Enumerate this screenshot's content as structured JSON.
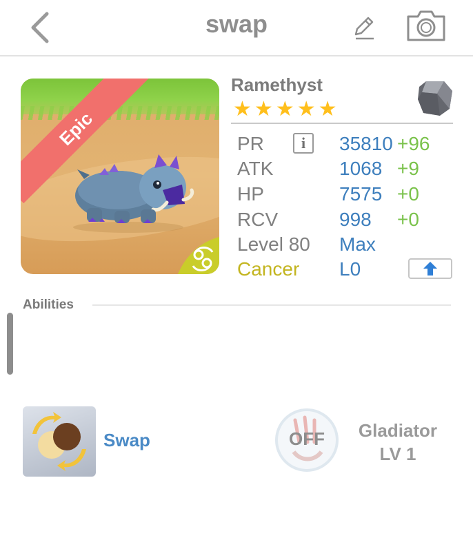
{
  "nav": {
    "title": "swap"
  },
  "card": {
    "rarity": "Epic"
  },
  "monster": {
    "name": "Ramethyst",
    "stars": 5,
    "element_icon": "gray-rock-gem-icon"
  },
  "stats": {
    "pr": {
      "label": "PR",
      "value": "35810",
      "bonus": "+96"
    },
    "atk": {
      "label": "ATK",
      "value": "1068",
      "bonus": "+9"
    },
    "hp": {
      "label": "HP",
      "value": "7575",
      "bonus": "+0"
    },
    "rcv": {
      "label": "RCV",
      "value": "998",
      "bonus": "+0"
    },
    "level": {
      "label": "Level 80",
      "value": "Max"
    },
    "sign": {
      "label": "Cancer",
      "value": "L0"
    }
  },
  "abilities": {
    "header": "Abilities",
    "skill": {
      "name": "Swap",
      "icon": "swap-skill-icon"
    },
    "leader": {
      "status": "OFF",
      "name": "Gladiator",
      "level": "LV 1",
      "icon": "claw-icon"
    }
  },
  "colors": {
    "accent_blue": "#3e7fbd",
    "bonus_green": "#7ac24b",
    "sign_yellow": "#c3b520",
    "ribbon_red": "#f1706c",
    "star_gold": "#ffbf1c"
  }
}
